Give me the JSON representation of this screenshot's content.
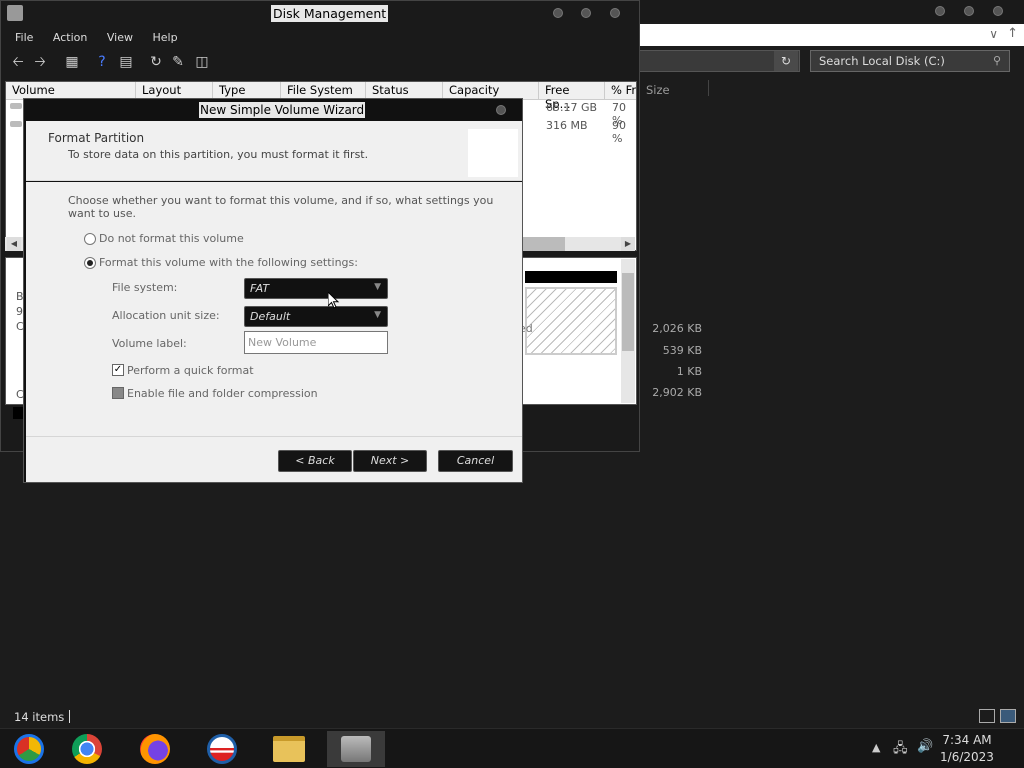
{
  "explorer": {
    "search_placeholder": "Search Local Disk (C:)",
    "column_size": "Size",
    "sizes": [
      "2,026 KB",
      "539 KB",
      "1 KB",
      "2,902 KB"
    ],
    "status_items": "14 items"
  },
  "disk_management": {
    "title": "Disk Management",
    "menu": [
      "File",
      "Action",
      "View",
      "Help"
    ],
    "columns": [
      "Volume",
      "Layout",
      "Type",
      "File System",
      "Status",
      "Capacity",
      "Free Sp...",
      "% Fr"
    ],
    "rows": [
      {
        "free": "65.17 GB",
        "pct": "70 %"
      },
      {
        "free": "316 MB",
        "pct": "90 %"
      }
    ],
    "lower_labels": [
      "B",
      "9",
      "C",
      "C"
    ],
    "disk_tag": "ed"
  },
  "wizard": {
    "title": "New Simple Volume Wizard",
    "header_title": "Format Partition",
    "header_subtitle": "To store data on this partition, you must format it first.",
    "intro": "Choose whether you want to format this volume, and if so, what settings you want to use.",
    "radio_no_format": "Do not format this volume",
    "radio_format": "Format this volume with the following settings:",
    "selected_option": "format",
    "file_system_label": "File system:",
    "file_system_value": "FAT",
    "alloc_label": "Allocation unit size:",
    "alloc_value": "Default",
    "volume_label_label": "Volume label:",
    "volume_label_value": "New Volume",
    "quick_format_label": "Perform a quick format",
    "quick_format_checked": true,
    "compression_label": "Enable file and folder compression",
    "compression_checked": false,
    "back_label": "< Back",
    "next_label": "Next >",
    "cancel_label": "Cancel"
  },
  "taskbar": {
    "apps": [
      "chrome-canary-icon",
      "chrome-icon",
      "firefox-icon",
      "obama-logo-icon",
      "file-explorer-icon",
      "disk-management-icon"
    ],
    "time": "7:34 AM",
    "date": "1/6/2023"
  }
}
